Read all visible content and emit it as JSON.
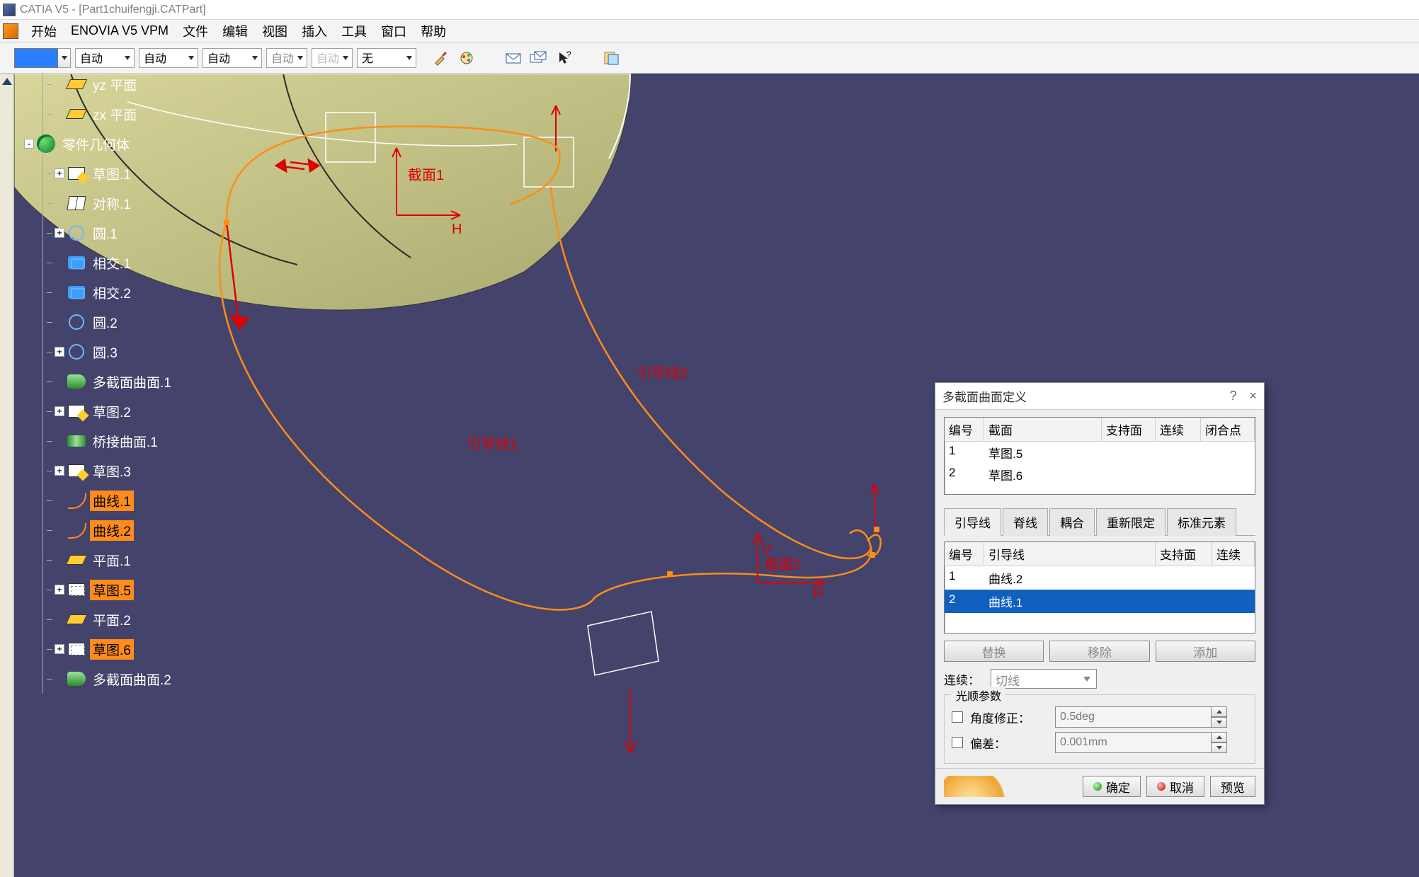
{
  "title": {
    "app": "CATIA V5",
    "doc": "[Part1chuifengji.CATPart]"
  },
  "menu": {
    "start": "开始",
    "enovia": "ENOVIA V5 VPM",
    "file": "文件",
    "edit": "编辑",
    "view": "视图",
    "insert": "插入",
    "tools": "工具",
    "window": "窗口",
    "help": "帮助"
  },
  "toolbar": {
    "auto1": "自动",
    "auto2": "自动",
    "auto3": "自动",
    "auto4": "自动",
    "auto5": "自动",
    "none": "无"
  },
  "tree": {
    "items": [
      {
        "icon": "plane",
        "label": "yz 平面",
        "exp": "",
        "indent": 1
      },
      {
        "icon": "plane",
        "label": "zx 平面",
        "exp": "",
        "indent": 1
      },
      {
        "icon": "gears",
        "label": "零件几何体",
        "exp": "-",
        "indent": 0
      },
      {
        "icon": "sketch",
        "label": "草图.1",
        "exp": "+",
        "indent": 1
      },
      {
        "icon": "sym",
        "label": "对称.1",
        "exp": "",
        "indent": 1
      },
      {
        "icon": "circ",
        "label": "圆.1",
        "exp": "+",
        "indent": 1
      },
      {
        "icon": "inter",
        "label": "相交.1",
        "exp": "",
        "indent": 1
      },
      {
        "icon": "inter",
        "label": "相交.2",
        "exp": "",
        "indent": 1
      },
      {
        "icon": "circ",
        "label": "圆.2",
        "exp": "",
        "indent": 1
      },
      {
        "icon": "circ",
        "label": "圆.3",
        "exp": "+",
        "indent": 1
      },
      {
        "icon": "loft",
        "label": "多截面曲面.1",
        "exp": "",
        "indent": 1
      },
      {
        "icon": "sketch",
        "label": "草图.2",
        "exp": "+",
        "indent": 1
      },
      {
        "icon": "bridge",
        "label": "桥接曲面.1",
        "exp": "",
        "indent": 1
      },
      {
        "icon": "sketch",
        "label": "草图.3",
        "exp": "+",
        "indent": 1
      },
      {
        "icon": "curve",
        "label": "曲线.1",
        "exp": "",
        "indent": 1,
        "hl": true
      },
      {
        "icon": "curve",
        "label": "曲线.2",
        "exp": "",
        "indent": 1,
        "hl": true
      },
      {
        "icon": "plane",
        "label": "平面.1",
        "exp": "",
        "indent": 1
      },
      {
        "icon": "sketch2",
        "label": "草图.5",
        "exp": "+",
        "indent": 1,
        "hl": true
      },
      {
        "icon": "plane",
        "label": "平面.2",
        "exp": "",
        "indent": 1
      },
      {
        "icon": "sketch2",
        "label": "草图.6",
        "exp": "+",
        "indent": 1,
        "hl": true
      },
      {
        "icon": "loft",
        "label": "多截面曲面.2",
        "exp": "",
        "indent": 1
      }
    ]
  },
  "canvas": {
    "label_section1": "截面1",
    "label_h1": "H",
    "label_guide1": "引导线1",
    "label_guide2": "引导线2",
    "label_section2": "截面2",
    "label_h2": "H",
    "label_v": "V"
  },
  "dialog": {
    "title": "多截面曲面定义",
    "help": "?",
    "close": "×",
    "list1": {
      "headers": {
        "no": "编号",
        "section": "截面",
        "support": "支持面",
        "cont": "连续",
        "closept": "闭合点"
      },
      "rows": [
        {
          "no": "1",
          "section": "草图.5"
        },
        {
          "no": "2",
          "section": "草图.6"
        }
      ]
    },
    "tabs": {
      "guide": "引导线",
      "spine": "脊线",
      "couple": "耦合",
      "relimit": "重新限定",
      "canon": "标准元素"
    },
    "list2": {
      "headers": {
        "no": "编号",
        "guide": "引导线",
        "support": "支持面",
        "cont": "连续"
      },
      "rows": [
        {
          "no": "1",
          "guide": "曲线.2"
        },
        {
          "no": "2",
          "guide": "曲线.1",
          "selected": true
        }
      ]
    },
    "buttons": {
      "replace": "替换",
      "remove": "移除",
      "add": "添加"
    },
    "cont_label": "连续：",
    "cont_value": "切线",
    "group_title": "光顺参数",
    "angle_label": "角度修正：",
    "angle_value": "0.5deg",
    "dev_label": "偏差：",
    "dev_value": "0.001mm",
    "ok": "确定",
    "cancel": "取消",
    "preview": "预览"
  }
}
